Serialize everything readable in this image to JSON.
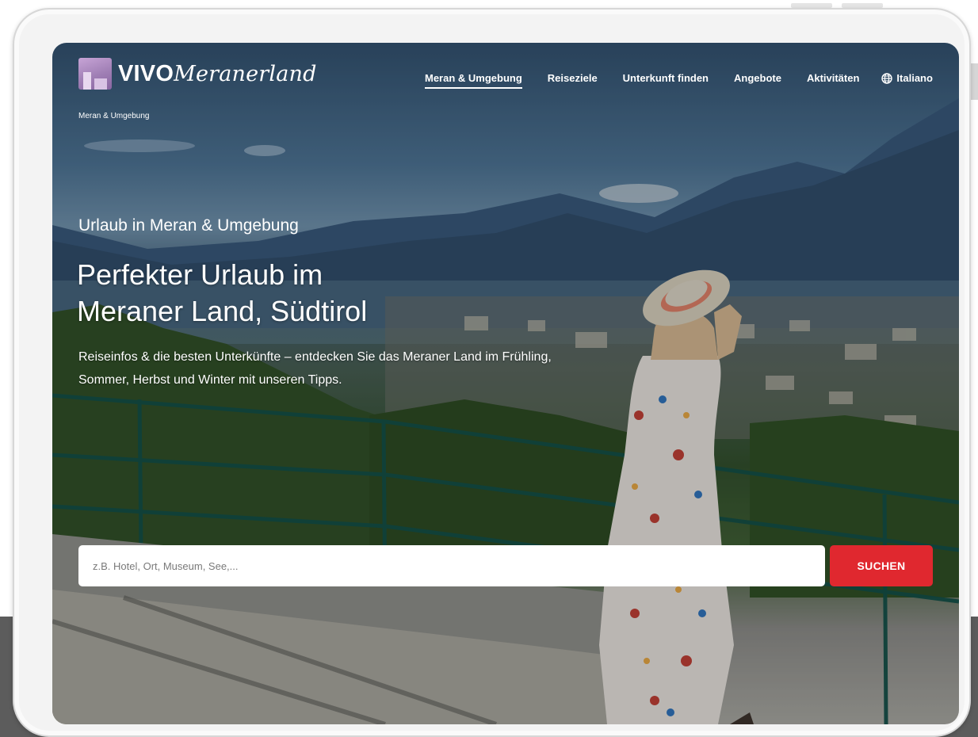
{
  "logo": {
    "brand_bold": "VIVO",
    "brand_rest": "Meranerland"
  },
  "nav": {
    "items": [
      {
        "label": "Meran & Umgebung",
        "active": true
      },
      {
        "label": "Reiseziele",
        "active": false
      },
      {
        "label": "Unterkunft finden",
        "active": false
      },
      {
        "label": "Angebote",
        "active": false
      },
      {
        "label": "Aktivitäten",
        "active": false
      }
    ],
    "language": "Italiano",
    "language_icon": "globe-icon"
  },
  "breadcrumb": "Meran & Umgebung",
  "hero": {
    "subtitle": "Urlaub in Meran & Umgebung",
    "title_line1": "Perfekter Urlaub im",
    "title_line2": "Meraner Land, Südtirol",
    "description": "Reiseinfos & die besten Unterkünfte – entdecken Sie das Meraner Land im Frühling, Sommer, Herbst und Winter mit unseren Tipps."
  },
  "search": {
    "placeholder": "z.B. Hotel, Ort, Museum, See,...",
    "value": "",
    "button_label": "SUCHEN"
  },
  "colors": {
    "accent": "#e0282f",
    "logo": "#a07fb5",
    "text": "#ffffff"
  }
}
